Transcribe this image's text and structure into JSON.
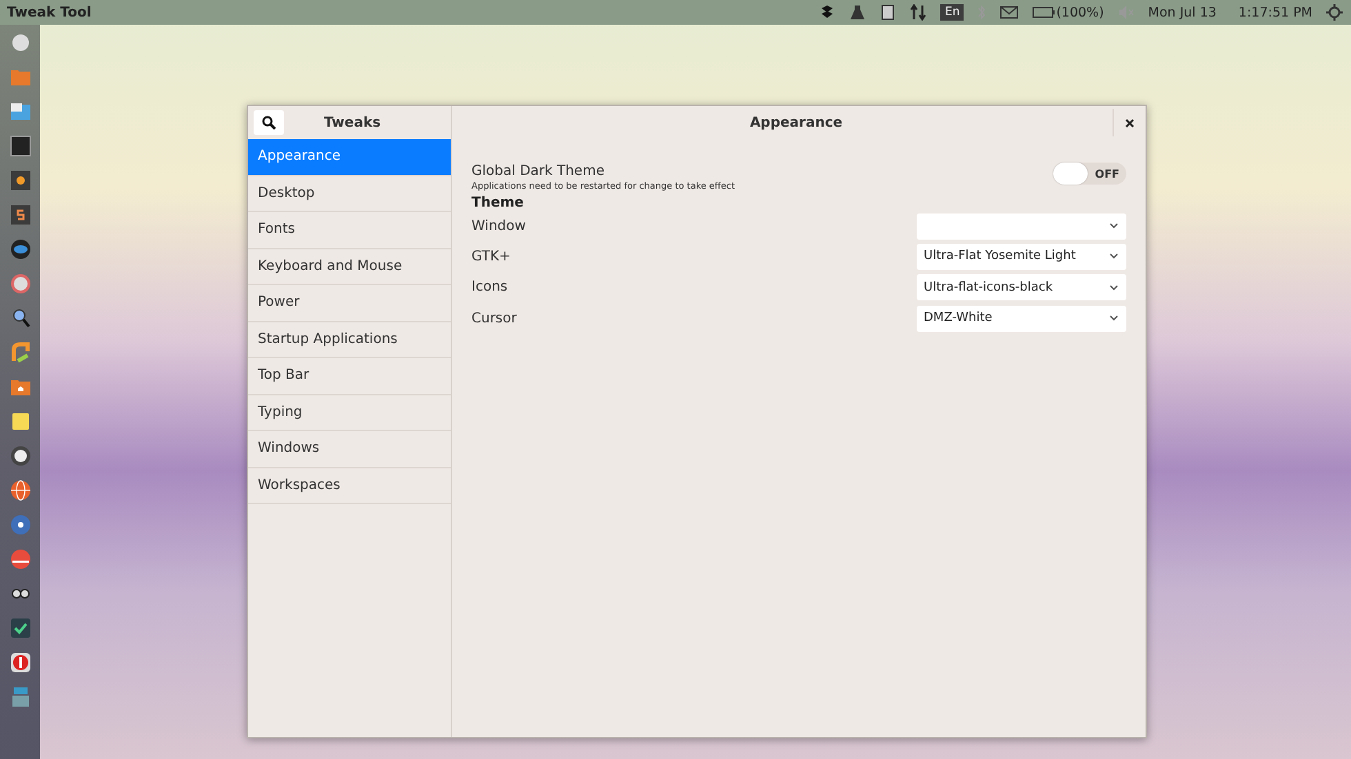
{
  "top_bar": {
    "app_name": "Tweak Tool",
    "keyboard_layout": "En",
    "battery": "(100%)",
    "date": "Mon Jul 13",
    "time": "1:17:51 PM"
  },
  "window": {
    "sidebar_title": "Tweaks",
    "title": "Appearance"
  },
  "sidebar": {
    "items": [
      {
        "label": "Appearance",
        "selected": true
      },
      {
        "label": "Desktop",
        "selected": false
      },
      {
        "label": "Fonts",
        "selected": false
      },
      {
        "label": "Keyboard and Mouse",
        "selected": false
      },
      {
        "label": "Power",
        "selected": false
      },
      {
        "label": "Startup Applications",
        "selected": false
      },
      {
        "label": "Top Bar",
        "selected": false
      },
      {
        "label": "Typing",
        "selected": false
      },
      {
        "label": "Windows",
        "selected": false
      },
      {
        "label": "Workspaces",
        "selected": false
      }
    ]
  },
  "dark_theme": {
    "label": "Global Dark Theme",
    "description": "Applications need to be restarted for change to take effect",
    "on": false,
    "state_label": "OFF"
  },
  "theme": {
    "heading": "Theme",
    "rows": [
      {
        "label": "Window"
      },
      {
        "label": "GTK+",
        "value": "Ultra-Flat Yosemite Light"
      },
      {
        "label": "Icons",
        "value": "Ultra-flat-icons-black"
      },
      {
        "label": "Cursor",
        "value": "DMZ-White"
      }
    ]
  }
}
